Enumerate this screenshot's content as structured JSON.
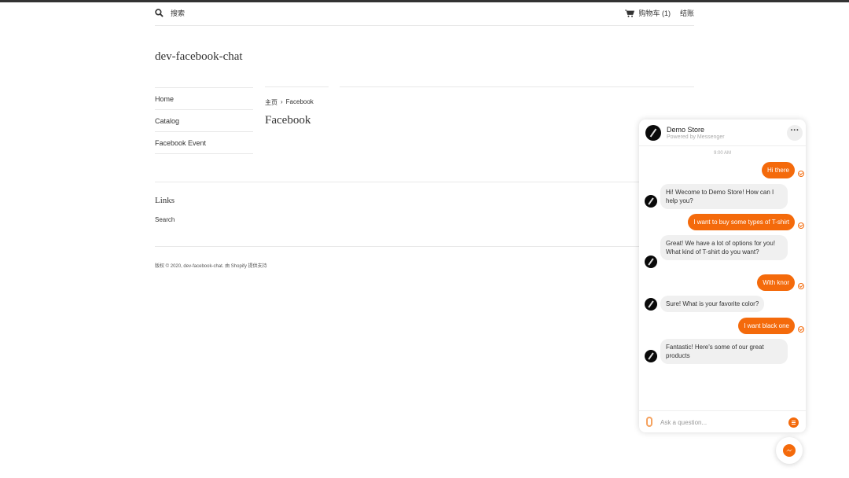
{
  "header": {
    "search_label": "搜索",
    "cart_label": "购物车 (1)",
    "checkout_label": "结账"
  },
  "site": {
    "title": "dev-facebook-chat"
  },
  "sidebar": {
    "items": [
      {
        "label": "Home"
      },
      {
        "label": "Catalog"
      },
      {
        "label": "Facebook Event"
      }
    ]
  },
  "breadcrumb": {
    "home": "主页",
    "separator": "›",
    "current": "Facebook"
  },
  "page": {
    "title": "Facebook"
  },
  "links": {
    "title": "Links",
    "search": "Search"
  },
  "footer": {
    "text": "版权 © 2020, dev-facebook-chat. 由 Shopify 提供支持"
  },
  "chat": {
    "store_name": "Demo Store",
    "powered_by": "Powered by Messenger",
    "time": "9:00 AM",
    "messages": [
      {
        "from": "user",
        "text": "Hi there"
      },
      {
        "from": "bot",
        "text": "Hi! Wecome to Demo Store! How can I help you?"
      },
      {
        "from": "user",
        "text": "I want to buy some types of T-shirt"
      },
      {
        "from": "bot",
        "text": "Great! We have a lot of options for you! What kind of T-shirt do you want?"
      },
      {
        "from": "user",
        "text": "With knor"
      },
      {
        "from": "bot",
        "text": "Sure! What is your favorite color?"
      },
      {
        "from": "user",
        "text": "I want black one"
      },
      {
        "from": "bot",
        "text": "Fantastic! Here's some of our great products"
      }
    ],
    "input_placeholder": "Ask a question..."
  },
  "colors": {
    "accent": "#f46a0b",
    "bot_bubble": "#f0f0f0",
    "text": "#333333"
  },
  "icons": {
    "search": "search-icon",
    "cart": "cart-icon",
    "more": "more-dots-icon",
    "attach": "paperclip-icon",
    "menu": "menu-icon",
    "messenger": "messenger-icon",
    "seen": "seen-check-icon"
  }
}
